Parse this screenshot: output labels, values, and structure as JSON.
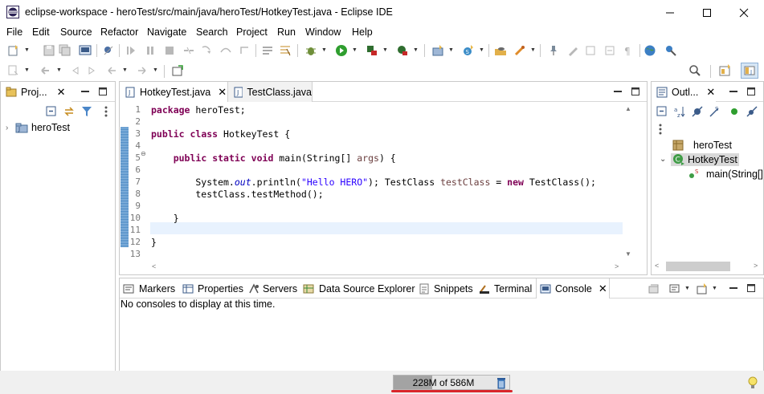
{
  "window": {
    "title": "eclipse-workspace - heroTest/src/main/java/heroTest/HotkeyTest.java - Eclipse IDE",
    "controls": [
      "minimize",
      "maximize",
      "close"
    ]
  },
  "menu": [
    "File",
    "Edit",
    "Source",
    "Refactor",
    "Navigate",
    "Search",
    "Project",
    "Run",
    "Window",
    "Help"
  ],
  "explorer": {
    "tab_label": "Proj...",
    "tree": [
      {
        "label": "heroTest",
        "icon": "java-project-icon",
        "expanded": false
      }
    ]
  },
  "editor": {
    "tabs": [
      {
        "label": "HotkeyTest.java",
        "active": true
      },
      {
        "label": "TestClass.java",
        "active": false
      }
    ],
    "line_numbers": [
      "1",
      "2",
      "3",
      "4",
      "5",
      "6",
      "7",
      "8",
      "9",
      "10",
      "11",
      "12",
      "13"
    ],
    "lines": [
      "package heroTest;",
      "",
      "public class HotkeyTest {",
      "",
      "    public static void main(String[] args) {",
      "",
      "        System.out.println(\"Hello HERO\"); TestClass testClass = new TestClass();",
      "        testClass.testMethod();",
      "",
      "    }",
      "",
      "}",
      ""
    ],
    "current_line": 11
  },
  "outline": {
    "tab_label": "Outl...",
    "items": [
      {
        "label": "heroTest",
        "icon": "package-icon"
      },
      {
        "label": "HotkeyTest",
        "icon": "class-icon",
        "selected": true
      },
      {
        "label": "main(String[]",
        "icon": "method-icon"
      }
    ]
  },
  "bottom": {
    "tabs": [
      {
        "label": "Markers",
        "icon": "markers-icon"
      },
      {
        "label": "Properties",
        "icon": "properties-icon"
      },
      {
        "label": "Servers",
        "icon": "servers-icon"
      },
      {
        "label": "Data Source Explorer",
        "icon": "data-source-icon"
      },
      {
        "label": "Snippets",
        "icon": "snippets-icon"
      },
      {
        "label": "Terminal",
        "icon": "terminal-icon"
      },
      {
        "label": "Console",
        "icon": "console-icon",
        "active": true
      }
    ],
    "console_message": "No consoles to display at this time."
  },
  "status": {
    "heap_label": "228M of 586M",
    "heap_used_fraction": 0.39
  },
  "colors": {
    "keyword": "#7f0055",
    "string": "#2a00ff",
    "field": "#0000c0",
    "local_var": "#6a3e3e",
    "current_line": "#e8f2fe",
    "heap_underline": "#d9262b"
  }
}
